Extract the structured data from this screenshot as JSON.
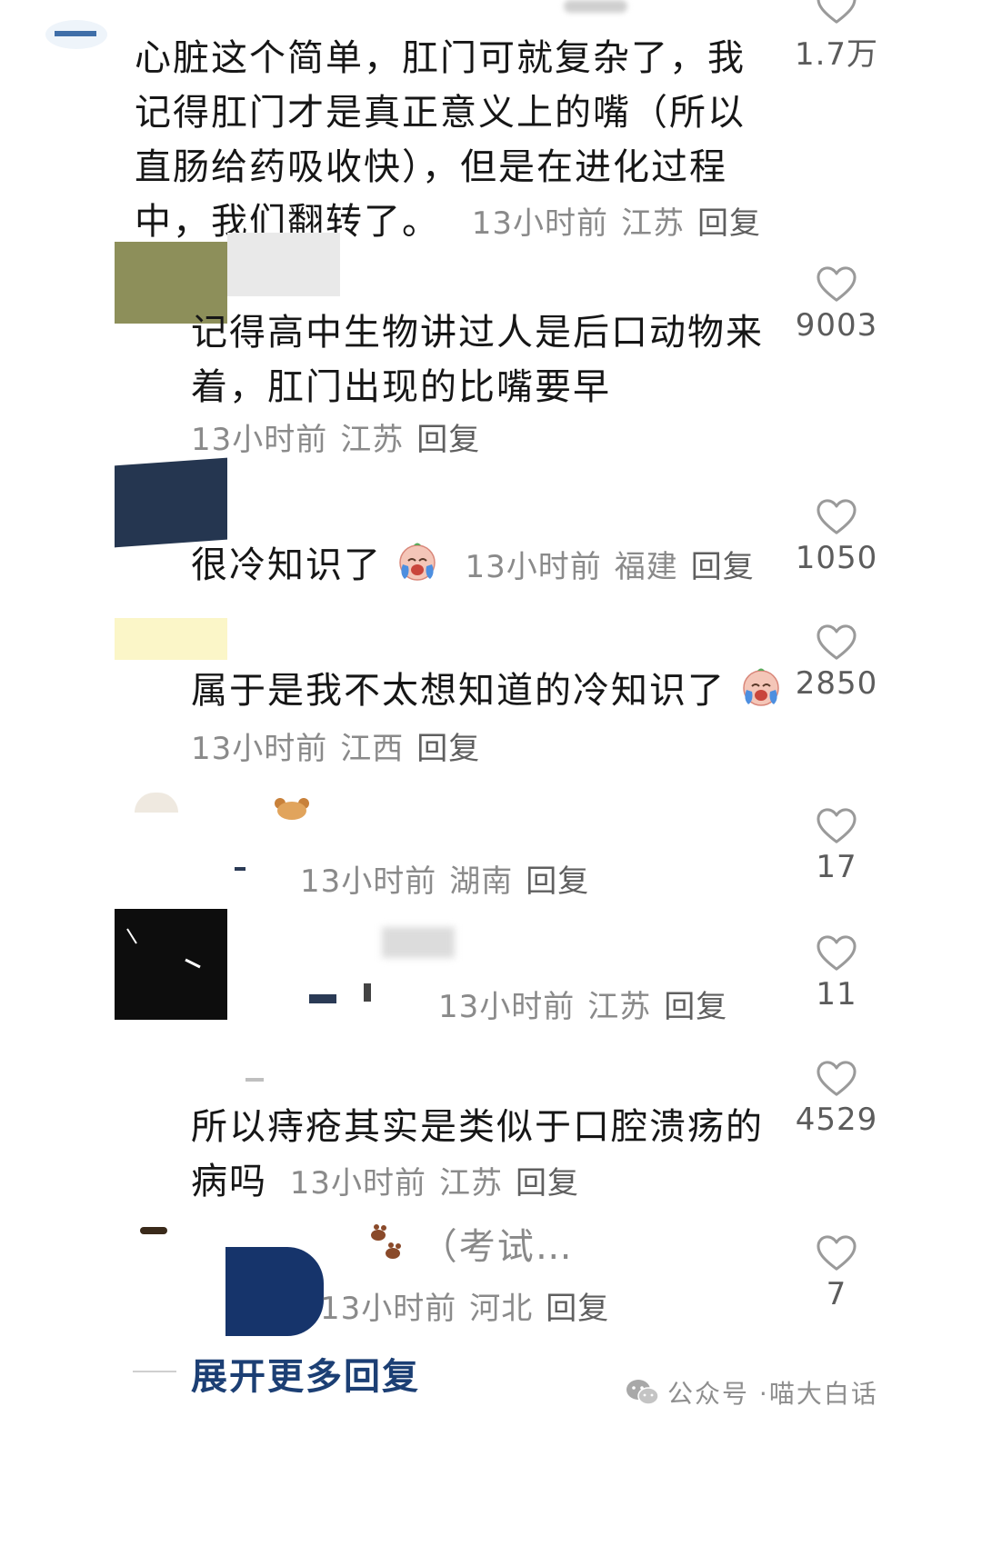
{
  "comments": [
    {
      "text_lines": [
        "心脏这个简单，肛门可就复杂了，我",
        "记得肛门才是真正意义上的嘴（所以",
        "直肠给药吸收快），但是在进化过程"
      ],
      "last_line": "中，我们翻转了。",
      "time": "13小时前",
      "location": "江苏",
      "reply": "回复",
      "likes": "1.7万"
    },
    {
      "text_lines": [
        "记得高中生物讲过人是后口动物来",
        "着，肛门出现的比嘴要早"
      ],
      "time": "13小时前",
      "location": "江苏",
      "reply": "回复",
      "likes": "9003"
    },
    {
      "text": "很冷知识了",
      "time": "13小时前",
      "location": "福建",
      "reply": "回复",
      "likes": "1050",
      "emoji": "crying-laughing-face"
    },
    {
      "text": "属于是我不太想知道的冷知识了",
      "time": "13小时前",
      "location": "江西",
      "reply": "回复",
      "likes": "2850",
      "emoji": "crying-laughing-face"
    },
    {
      "time": "13小时前",
      "location": "湖南",
      "reply": "回复",
      "likes": "17"
    },
    {
      "time": "13小时前",
      "location": "江苏",
      "reply": "回复",
      "likes": "11"
    },
    {
      "text_lines": [
        "所以痔疮其实是类似于口腔溃疡的"
      ],
      "last_line": "病吗",
      "time": "13小时前",
      "location": "江苏",
      "reply": "回复",
      "likes": "4529"
    },
    {
      "text": "（考试…",
      "time": "13小时前",
      "location": "河北",
      "reply": "回复",
      "likes": "7",
      "emoji": "paw-prints"
    }
  ],
  "expand_label": "展开更多回复",
  "watermark": {
    "prefix": "公众号 · ",
    "account": "喵大白话",
    "icon": "wechat-icon"
  },
  "colors": {
    "text": "#161616",
    "meta": "#8a8a8a",
    "expand": "#1c3f74",
    "heart": "#9a9a9a"
  }
}
